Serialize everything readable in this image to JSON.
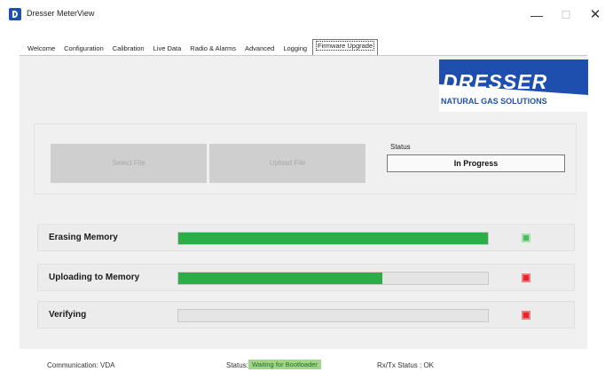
{
  "window": {
    "title": "Dresser MeterView",
    "minimize_glyph": "—",
    "maximize_glyph": "☐",
    "close_glyph": "✕"
  },
  "tabs": [
    {
      "label": "Welcome",
      "active": false
    },
    {
      "label": "Configuration",
      "active": false
    },
    {
      "label": "Calibration",
      "active": false
    },
    {
      "label": "Live Data",
      "active": false
    },
    {
      "label": "Radio & Alarms",
      "active": false
    },
    {
      "label": "Advanced",
      "active": false
    },
    {
      "label": "Logging",
      "active": false
    },
    {
      "label": "Firmware Upgrade",
      "active": true
    }
  ],
  "logo": {
    "name": "DRESSER",
    "tagline": "NATURAL GAS SOLUTIONS",
    "color": "#1f4fae"
  },
  "actions": {
    "select_file_label": "Select File",
    "upload_file_label": "Upload File"
  },
  "status": {
    "label": "Status",
    "value": "In Progress"
  },
  "steps": [
    {
      "label": "Erasing Memory",
      "progress": 1.0,
      "indicator": "green"
    },
    {
      "label": "Uploading to Memory",
      "progress": 0.66,
      "indicator": "red"
    },
    {
      "label": "Verifying",
      "progress": 0.0,
      "indicator": "red"
    }
  ],
  "colors": {
    "progress_fill": "#2cae46",
    "indicator_green": "#4cbd5e",
    "indicator_red": "#e4252a"
  },
  "statusbar": {
    "communication": "Communication: VDA",
    "status_label": "Status:",
    "status_value": "Waiting for Bootloader",
    "rxtx": "Rx/Tx Status : OK"
  }
}
